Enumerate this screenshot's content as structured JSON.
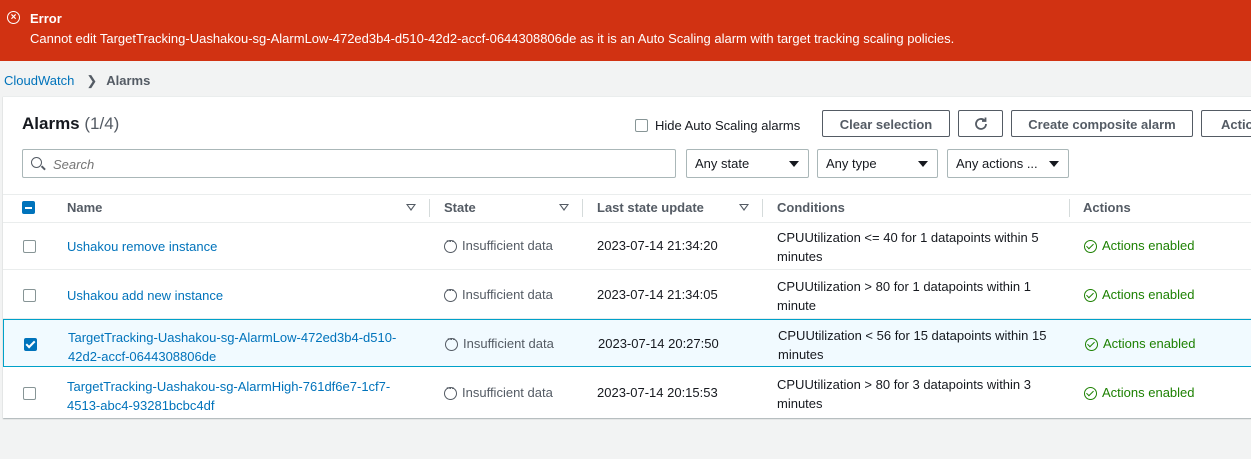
{
  "error": {
    "icon": "error-x-icon",
    "title": "Error",
    "message": "Cannot edit TargetTracking-Uashakou-sg-AlarmLow-472ed3b4-d510-42d2-accf-0644308806de as it is an Auto Scaling alarm with target tracking scaling policies."
  },
  "breadcrumb": {
    "root": "CloudWatch",
    "current": "Alarms"
  },
  "panel": {
    "title": "Alarms",
    "count": "(1/4)",
    "hide_autoscaling_label": "Hide Auto Scaling alarms",
    "clear_selection": "Clear selection",
    "create_composite": "Create composite alarm",
    "actions": "Actio"
  },
  "filters": {
    "search_placeholder": "Search",
    "state": "Any state",
    "type": "Any type",
    "actions": "Any actions ..."
  },
  "columns": [
    "Name",
    "State",
    "Last state update",
    "Conditions",
    "Actions"
  ],
  "rows": [
    {
      "name": "Ushakou remove instance",
      "state": "Insufficient data",
      "updated": "2023-07-14 21:34:20",
      "condition": "CPUUtilization <= 40 for 1 datapoints within 5 minutes",
      "actions": "Actions enabled",
      "selected": false
    },
    {
      "name": "Ushakou add new instance",
      "state": "Insufficient data",
      "updated": "2023-07-14 21:34:05",
      "condition": "CPUUtilization > 80 for 1 datapoints within 1 minute",
      "actions": "Actions enabled",
      "selected": false
    },
    {
      "name": "TargetTracking-Uashakou-sg-AlarmLow-472ed3b4-d510-42d2-accf-0644308806de",
      "state": "Insufficient data",
      "updated": "2023-07-14 20:27:50",
      "condition": "CPUUtilization < 56 for 15 datapoints within 15 minutes",
      "actions": "Actions enabled",
      "selected": true
    },
    {
      "name": "TargetTracking-Uashakou-sg-AlarmHigh-761df6e7-1cf7-4513-abc4-93281bcbc4df",
      "state": "Insufficient data",
      "updated": "2023-07-14 20:15:53",
      "condition": "CPUUtilization > 80 for 3 datapoints within 3 minutes",
      "actions": "Actions enabled",
      "selected": false
    }
  ]
}
